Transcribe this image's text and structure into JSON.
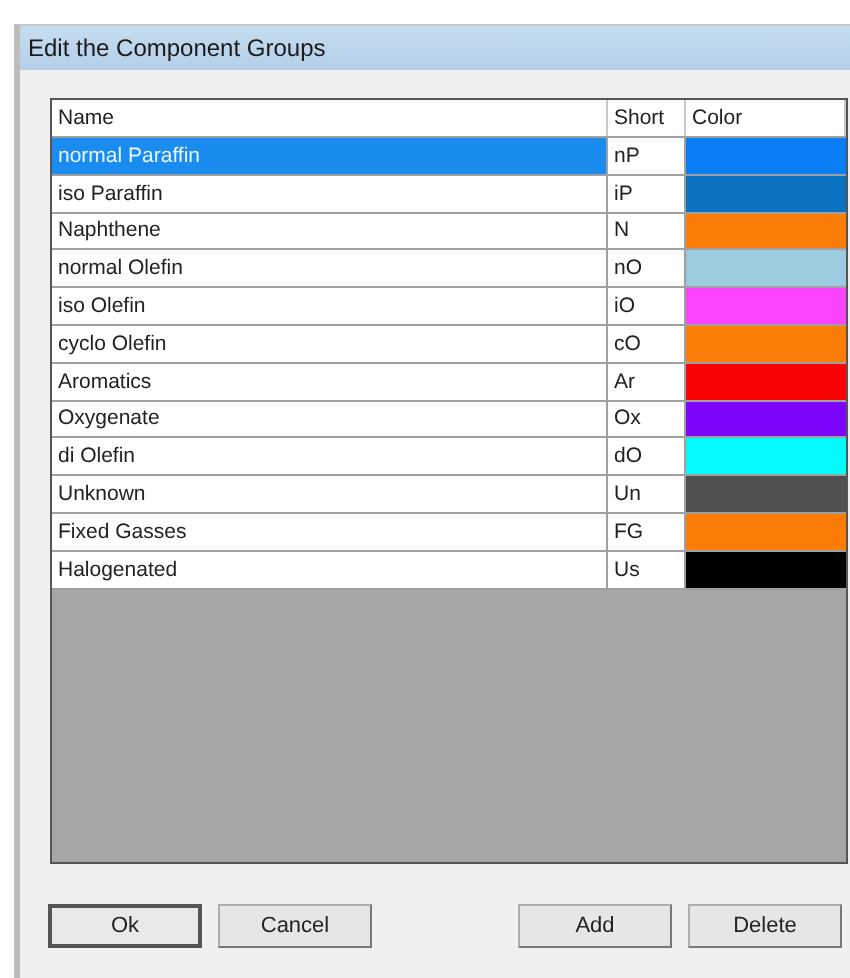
{
  "window": {
    "title": "Edit the Component Groups"
  },
  "table": {
    "columns": [
      "Name",
      "Short",
      "Color"
    ],
    "rows": [
      {
        "name": "normal Paraffin",
        "short": "nP",
        "color": "#0a7ff5",
        "selected": true
      },
      {
        "name": "iso Paraffin",
        "short": "iP",
        "color": "#0b72c0",
        "selected": false
      },
      {
        "name": "Naphthene",
        "short": "N",
        "color": "#fb7d07",
        "selected": false
      },
      {
        "name": "normal Olefin",
        "short": "nO",
        "color": "#9ccbe0",
        "selected": false
      },
      {
        "name": "iso Olefin",
        "short": "iO",
        "color": "#fb43fb",
        "selected": false
      },
      {
        "name": "cyclo Olefin",
        "short": "cO",
        "color": "#fb7d07",
        "selected": false
      },
      {
        "name": "Aromatics",
        "short": "Ar",
        "color": "#fb0205",
        "selected": false
      },
      {
        "name": "Oxygenate",
        "short": "Ox",
        "color": "#7d05fb",
        "selected": false
      },
      {
        "name": "di Olefin",
        "short": "dO",
        "color": "#05fbfb",
        "selected": false
      },
      {
        "name": "Unknown",
        "short": "Un",
        "color": "#505050",
        "selected": false
      },
      {
        "name": "Fixed Gasses",
        "short": "FG",
        "color": "#fb7d07",
        "selected": false
      },
      {
        "name": "Halogenated",
        "short": "Us",
        "color": "#000000",
        "selected": false
      }
    ]
  },
  "buttons": [
    {
      "label": "Ok",
      "kind": "default"
    },
    {
      "label": "Cancel",
      "kind": "normal"
    },
    {
      "label": "Add",
      "kind": "normal"
    },
    {
      "label": "Delete",
      "kind": "normal"
    }
  ]
}
